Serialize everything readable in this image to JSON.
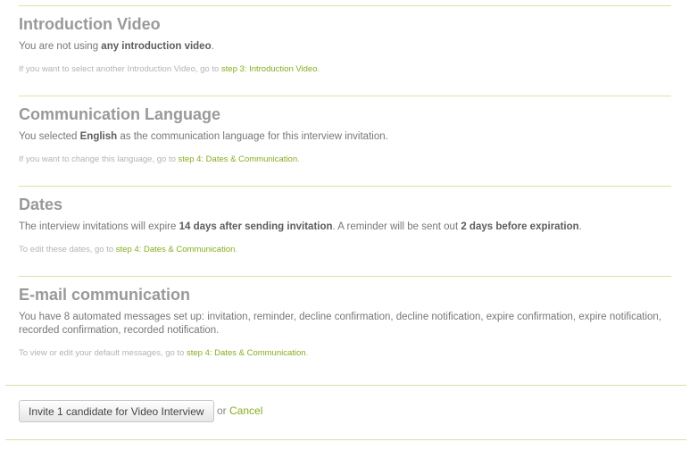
{
  "intro_video": {
    "title": "Introduction Video",
    "body_pre": "You are not using ",
    "body_bold": "any introduction video",
    "body_post": ".",
    "hint_pre": "If you want to select another Introduction Video, go to ",
    "hint_link": "step 3: Introduction Video",
    "hint_post": "."
  },
  "language": {
    "title": "Communication Language",
    "body_pre": "You selected ",
    "body_bold": "English",
    "body_post": " as the communication language for this interview invitation.",
    "hint_pre": "If you want to change this language, go to ",
    "hint_link": "step 4: Dates & Communication",
    "hint_post": "."
  },
  "dates": {
    "title": "Dates",
    "body_pre": "The interview invitations will expire ",
    "body_bold1": "14 days after sending invitation",
    "body_mid": ". A reminder will be sent out ",
    "body_bold2": "2 days before expiration",
    "body_post": ".",
    "hint_pre": "To edit these dates, go to ",
    "hint_link": "step 4: Dates & Communication",
    "hint_post": "."
  },
  "email": {
    "title": "E-mail communication",
    "body": "You have 8 automated messages set up: invitation, reminder, decline confirmation, decline notification, expire confirmation, expire notification, recorded confirmation, recorded notification.",
    "hint_pre": "To view or edit your default messages, go to ",
    "hint_link": "step 4: Dates & Communication",
    "hint_post": "."
  },
  "actions": {
    "invite_label": "Invite 1 candidate for Video Interview",
    "or_text": "or ",
    "cancel_label": "Cancel"
  },
  "colors": {
    "divider": "#d5e4a6",
    "link": "#86ad1e",
    "title": "#999999"
  }
}
